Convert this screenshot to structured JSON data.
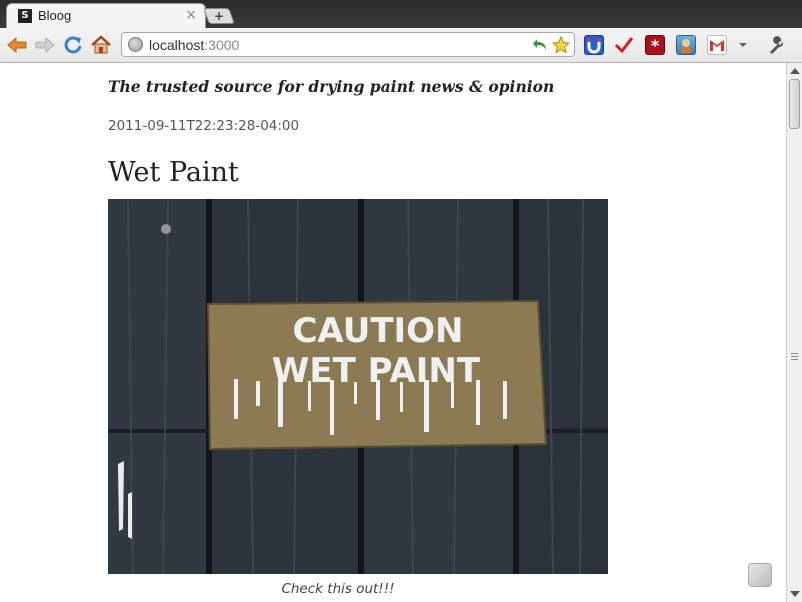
{
  "browser": {
    "tab_title": "Bloog",
    "tab_favicon_letter": "S",
    "url_host": "localhost",
    "url_port": ":3000",
    "new_tab_symbol": "+",
    "close_tab_symbol": "×"
  },
  "toolbar_icons": [
    "back-arrow-icon",
    "forward-arrow-icon",
    "reload-icon",
    "home-icon",
    "bookmark-star-icon",
    "extension-icons",
    "wrench-icon"
  ],
  "page": {
    "tagline": "The trusted source for drying paint news & opinion",
    "timestamp": "2011-09-11T22:23:28-04:00",
    "post_title": "Wet Paint",
    "image_sign_line1": "CAUTION",
    "image_sign_line2": "WET PAINT",
    "caption": "Check this out!!!"
  },
  "colors": {
    "sign_board": "#8c7b52",
    "wood_dark": "#2a3038"
  }
}
